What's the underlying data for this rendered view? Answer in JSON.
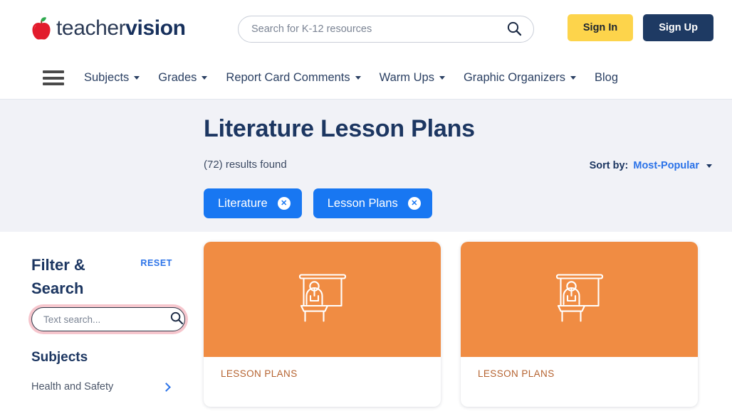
{
  "brand": {
    "name_light": "teacher",
    "name_bold": "vision",
    "apple_icon": "apple-icon"
  },
  "header": {
    "search": {
      "placeholder": "Search for K-12 resources",
      "value": "",
      "icon": "search-icon"
    },
    "sign_in_label": "Sign In",
    "sign_up_label": "Sign Up",
    "colors": {
      "sign_in_bg": "#fdd44b",
      "sign_up_bg": "#1e3a63"
    }
  },
  "nav": {
    "menu_icon": "hamburger-menu-icon",
    "items": [
      {
        "label": "Subjects",
        "has_caret": true
      },
      {
        "label": "Grades",
        "has_caret": true
      },
      {
        "label": "Report Card Comments",
        "has_caret": true
      },
      {
        "label": "Warm Ups",
        "has_caret": true
      },
      {
        "label": "Graphic Organizers",
        "has_caret": true
      },
      {
        "label": "Blog",
        "has_caret": false
      }
    ]
  },
  "hero": {
    "title": "Literature Lesson Plans",
    "results_text": "(72) results found",
    "sort": {
      "label": "Sort by:",
      "value": "Most-Popular"
    },
    "chips": [
      {
        "label": "Literature",
        "close_icon": "close-icon"
      },
      {
        "label": "Lesson Plans",
        "close_icon": "close-icon"
      }
    ],
    "background": "#f1f2f7"
  },
  "sidebar": {
    "title": "Filter & Search",
    "reset_label": "RESET",
    "text_search": {
      "placeholder": "Text search...",
      "value": "",
      "icon": "search-icon"
    },
    "subjects_heading": "Subjects",
    "subjects": [
      {
        "label": "Health and Safety",
        "chevron": "chevron-right-icon"
      }
    ]
  },
  "results": {
    "cards": [
      {
        "kicker": "LESSON PLANS",
        "thumb_icon": "teacher-presentation-icon",
        "thumb_color": "#f08c43"
      },
      {
        "kicker": "LESSON PLANS",
        "thumb_icon": "teacher-presentation-icon",
        "thumb_color": "#f08c43"
      }
    ]
  }
}
